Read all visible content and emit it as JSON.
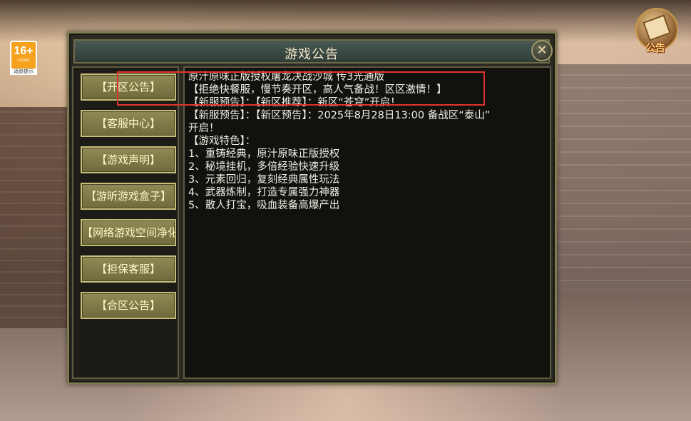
{
  "age_badge": {
    "rating": "16+",
    "org": "CADPA",
    "tip": "适龄提示"
  },
  "notice_icon": {
    "label": "公告"
  },
  "panel": {
    "title": "游戏公告",
    "close_glyph": "✕"
  },
  "sidebar": {
    "items": [
      {
        "label": "【开区公告】"
      },
      {
        "label": "【客服中心】"
      },
      {
        "label": "【游戏声明】"
      },
      {
        "label": "【游昕游戏盒子】"
      },
      {
        "label": "【网络游戏空间净化"
      },
      {
        "label": "【担保客服】"
      },
      {
        "label": "【合区公告】"
      }
    ]
  },
  "content": {
    "lines": [
      "原汁原味正版授权屠龙决战沙城 传3光通版",
      "【拒绝快餐服，慢节奏开区，高人气备战！区区激情！】",
      "【新服预告】：【新区推荐】：新区“苍穹”开启！",
      "【新服预告】：【新区预告】：2025年8月28日13:00 备战区“泰山”",
      "开启！",
      "【游戏特色】：",
      "1、重铸经典，原汁原味正版授权",
      "2、秘境挂机，多倍经验快速升级",
      "3、元素回归，复刻经典属性玩法",
      "4、武器炼制，打造专属强力神器",
      "5、散人打宝，吸血装备高爆产出"
    ]
  },
  "colors": {
    "highlight": "#e0332f",
    "button_gold": "#8f8a55",
    "panel_bg": "#2b2a22"
  }
}
